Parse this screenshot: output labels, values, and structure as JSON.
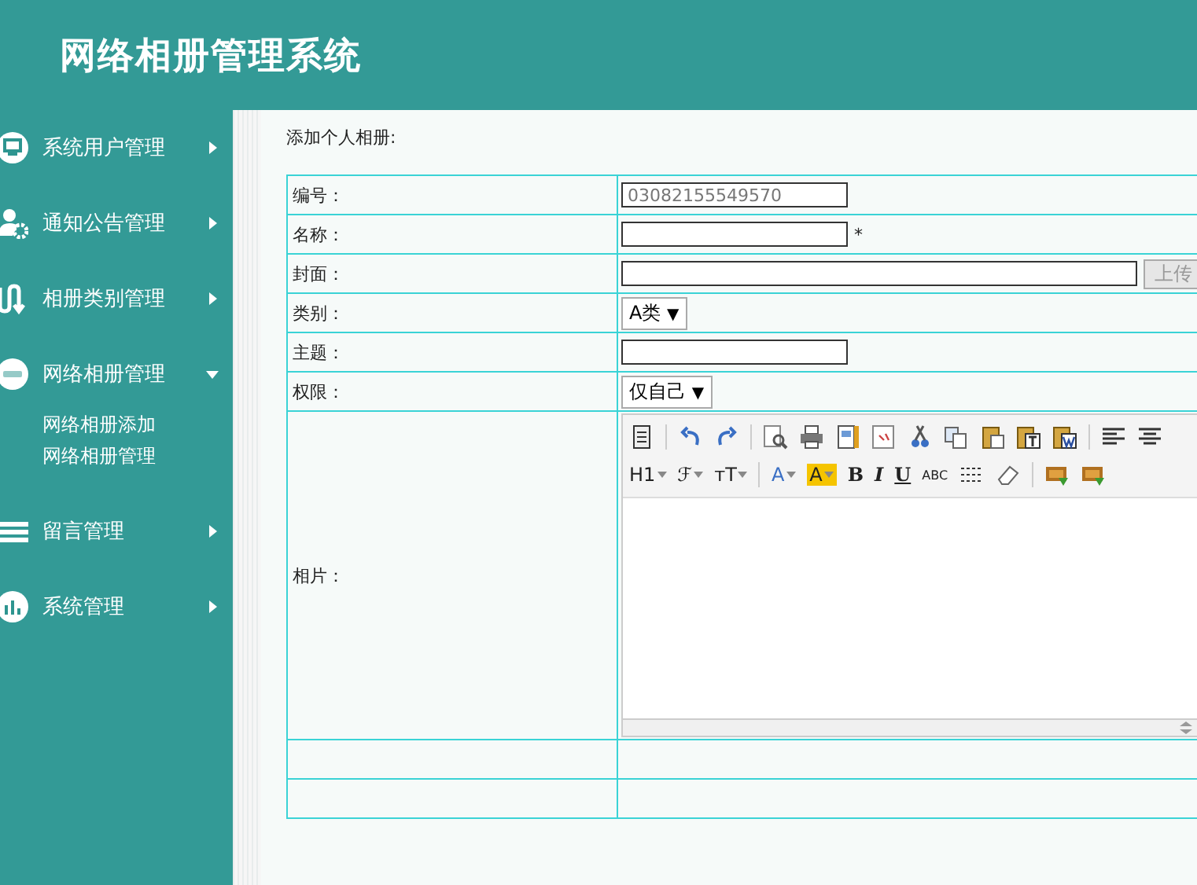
{
  "header": {
    "title": "网络相册管理系统"
  },
  "sidebar": {
    "items": [
      {
        "label": "系统用户管理",
        "expanded": false
      },
      {
        "label": "通知公告管理",
        "expanded": false
      },
      {
        "label": "相册类别管理",
        "expanded": false
      },
      {
        "label": "网络相册管理",
        "expanded": true,
        "children": [
          {
            "label": "网络相册添加"
          },
          {
            "label": "网络相册管理"
          }
        ]
      },
      {
        "label": "留言管理",
        "expanded": false
      },
      {
        "label": "系统管理",
        "expanded": false
      }
    ]
  },
  "form": {
    "title": "添加个人相册:",
    "rows": [
      {
        "kind": "input",
        "label": "编号：",
        "value": "03082155549570"
      },
      {
        "kind": "input",
        "label": "名称：",
        "required": "*"
      },
      {
        "kind": "upload",
        "label": "封面：",
        "button": "上传"
      },
      {
        "kind": "select",
        "label": "类别：",
        "value": "A类",
        "arrow": "▼"
      },
      {
        "kind": "input",
        "label": "主题："
      },
      {
        "kind": "select",
        "label": "权限：",
        "value": "仅自己",
        "arrow": "▼"
      },
      {
        "kind": "editor",
        "label": "相片：",
        "toolbar": [
          [
            {
              "kind": "icon"
            },
            {
              "kind": "separator"
            },
            {
              "kind": "icon"
            },
            {
              "kind": "icon"
            },
            {
              "kind": "separator"
            },
            {
              "kind": "icon"
            },
            {
              "kind": "icon"
            },
            {
              "kind": "icon"
            },
            {
              "kind": "icon"
            },
            {
              "kind": "icon"
            },
            {
              "kind": "icon"
            },
            {
              "kind": "icon"
            },
            {
              "kind": "icon"
            },
            {
              "kind": "icon"
            },
            {
              "kind": "separator"
            },
            {
              "kind": "icon"
            },
            {
              "kind": "icon"
            }
          ],
          [
            {
              "kind": "dropdown",
              "text": "H1"
            },
            {
              "kind": "dropdown",
              "text": "ℱ"
            },
            {
              "kind": "dropdown",
              "text": "тT"
            },
            {
              "kind": "separator"
            },
            {
              "kind": "dropdown",
              "text": "A"
            },
            {
              "kind": "dropdown",
              "text": "A"
            },
            {
              "kind": "text",
              "text": "B"
            },
            {
              "kind": "text",
              "text": "I"
            },
            {
              "kind": "text",
              "text": "U"
            },
            {
              "kind": "text",
              "text": "ABC"
            },
            {
              "kind": "icon"
            },
            {
              "kind": "icon"
            },
            {
              "kind": "separator"
            },
            {
              "kind": "icon"
            },
            {
              "kind": "icon"
            }
          ]
        ]
      },
      {
        "kind": "blank"
      },
      {
        "kind": "blank"
      }
    ]
  }
}
